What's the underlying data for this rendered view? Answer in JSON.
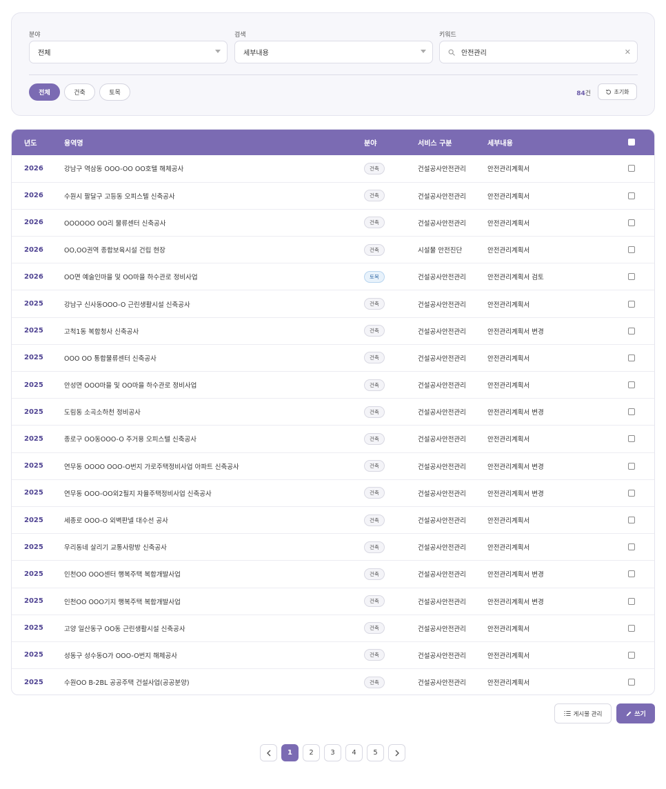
{
  "filters": {
    "field_label": "분야",
    "field_value": "전체",
    "search_type_label": "검색",
    "search_type_value": "세부내용",
    "keyword_label": "키워드",
    "keyword_value": "안전관리",
    "clear_icon": "close-icon"
  },
  "chips": [
    "전체",
    "건축",
    "토목"
  ],
  "active_chip": "전체",
  "result_count": {
    "number": "84",
    "unit": "건"
  },
  "reset_label": "초기화",
  "table": {
    "headers": {
      "year": "년도",
      "name": "용역명",
      "field": "분야",
      "service": "서비스 구분",
      "detail": "세부내용"
    },
    "rows": [
      {
        "year": "2026",
        "name": "강남구 역삼동 OOO-OO OO호텔 해체공사",
        "field": "건축",
        "service": "건설공사안전관리",
        "detail": "안전관리계획서"
      },
      {
        "year": "2026",
        "name": "수원시 팔달구 고등동 오피스텔 신축공사",
        "field": "건축",
        "service": "건설공사안전관리",
        "detail": "안전관리계획서"
      },
      {
        "year": "2026",
        "name": "OOOOOO OO리 물류센터 신축공사",
        "field": "건축",
        "service": "건설공사안전관리",
        "detail": "안전관리계획서"
      },
      {
        "year": "2026",
        "name": "OO,OO권역 종합보육시설 건립 현장",
        "field": "건축",
        "service": "시설물 안전진단",
        "detail": "안전관리계획서"
      },
      {
        "year": "2026",
        "name": "OO면 예술인마을 및 OO마을 하수관로 정비사업",
        "field": "토목",
        "service": "건설공사안전관리",
        "detail": "안전관리계획서 검토"
      },
      {
        "year": "2025",
        "name": "강남구 신사동OOO-O 근린생활시설 신축공사",
        "field": "건축",
        "service": "건설공사안전관리",
        "detail": "안전관리계획서"
      },
      {
        "year": "2025",
        "name": "고척1동 복합청사 신축공사",
        "field": "건축",
        "service": "건설공사안전관리",
        "detail": "안전관리계획서 변경"
      },
      {
        "year": "2025",
        "name": "OOO OO 통합물류센터 신축공사",
        "field": "건축",
        "service": "건설공사안전관리",
        "detail": "안전관리계획서"
      },
      {
        "year": "2025",
        "name": "안성면 OOO마을 및 OO마을 하수관로 정비사업",
        "field": "건축",
        "service": "건설공사안전관리",
        "detail": "안전관리계획서"
      },
      {
        "year": "2025",
        "name": "도림동 소곡소하천 정비공사",
        "field": "건축",
        "service": "건설공사안전관리",
        "detail": "안전관리계획서 변경"
      },
      {
        "year": "2025",
        "name": "종로구 OO동OOO-O 주거용 오피스텔 신축공사",
        "field": "건축",
        "service": "건설공사안전관리",
        "detail": "안전관리계획서"
      },
      {
        "year": "2025",
        "name": "연무동 OOOO OOO-O번지 가로주택정비사업 아파트 신축공사",
        "field": "건축",
        "service": "건설공사안전관리",
        "detail": "안전관리계획서 변경"
      },
      {
        "year": "2025",
        "name": "연무동 OOO-OO외2필지 자율주택정비사업 신축공사",
        "field": "건축",
        "service": "건설공사안전관리",
        "detail": "안전관리계획서 변경"
      },
      {
        "year": "2025",
        "name": "세종로 OOO-O 외벽판넬 대수선 공사",
        "field": "건축",
        "service": "건설공사안전관리",
        "detail": "안전관리계획서"
      },
      {
        "year": "2025",
        "name": "우리동네 살리기 교통사랑방 신축공사",
        "field": "건축",
        "service": "건설공사안전관리",
        "detail": "안전관리계획서"
      },
      {
        "year": "2025",
        "name": "인천OO OOO센터 행복주택 복합개발사업",
        "field": "건축",
        "service": "건설공사안전관리",
        "detail": "안전관리계획서 변경"
      },
      {
        "year": "2025",
        "name": "인천OO OOO기지 행복주택 복합개발사업",
        "field": "건축",
        "service": "건설공사안전관리",
        "detail": "안전관리계획서 변경"
      },
      {
        "year": "2025",
        "name": "고양 일산동구 OO동 근린생활시설 신축공사",
        "field": "건축",
        "service": "건설공사안전관리",
        "detail": "안전관리계획서"
      },
      {
        "year": "2025",
        "name": "성동구 성수동O가 OOO-O번지 해체공사",
        "field": "건축",
        "service": "건설공사안전관리",
        "detail": "안전관리계획서"
      },
      {
        "year": "2025",
        "name": "수원OO B-2BL 공공주택 건설사업(공공분양)",
        "field": "건축",
        "service": "건설공사안전관리",
        "detail": "안전관리계획서"
      }
    ]
  },
  "actions": {
    "manage_label": "게시물 관리",
    "write_label": "쓰기"
  },
  "pagination": {
    "pages": [
      "1",
      "2",
      "3",
      "4",
      "5"
    ],
    "current": "1",
    "prev_icon": "chevron-left-icon",
    "next_icon": "chevron-right-icon"
  },
  "colors": {
    "accent": "#7b6bb3",
    "year_text": "#4f4392",
    "civil_tag": "#3a6fa8"
  }
}
